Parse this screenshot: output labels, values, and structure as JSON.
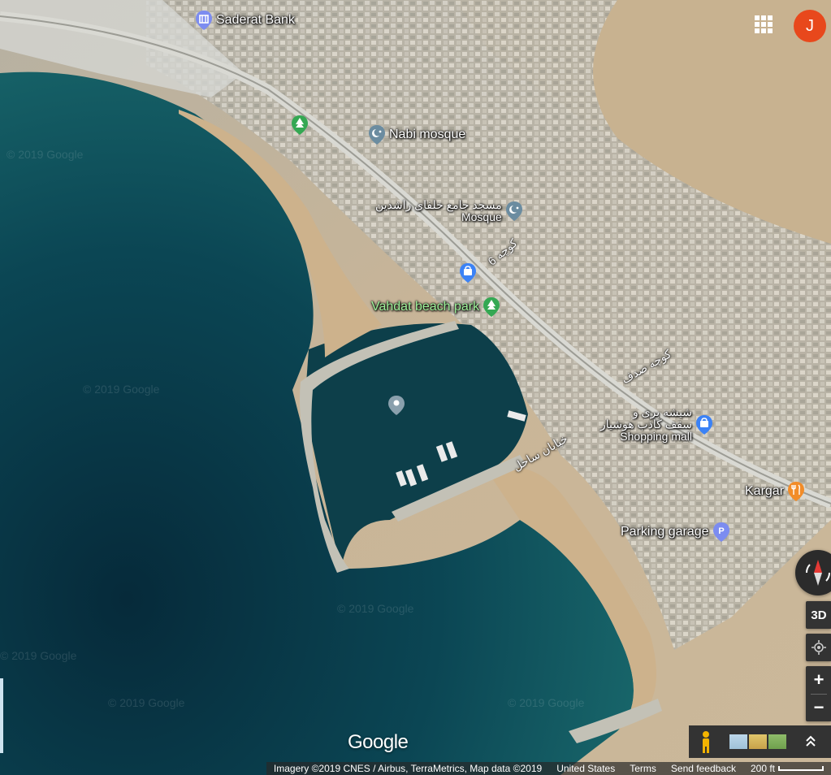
{
  "pois": [
    {
      "key": "saderat",
      "label": "Saderat Bank",
      "icon": "bank-pin-icon"
    },
    {
      "key": "nabi",
      "label": "Nabi mosque",
      "icon": "mosque-pin-icon"
    },
    {
      "key": "mosque_fa",
      "label": "مسجد جامع خلفای راشدین",
      "sublabel": "Mosque",
      "icon": "mosque-pin-icon"
    },
    {
      "key": "vahdat",
      "label": "Vahdat beach park",
      "icon": "park-pin-icon"
    },
    {
      "key": "mall_fa",
      "label": "شیشه بری و",
      "label2": "سقف کاذب هوشیار",
      "sublabel": "Shopping mall",
      "icon": "shopping-pin-icon"
    },
    {
      "key": "kargar",
      "label": "Kargar",
      "icon": "restaurant-pin-icon"
    },
    {
      "key": "parking",
      "label": "Parking garage",
      "icon": "parking-pin-icon"
    }
  ],
  "roads": {
    "r1": "کوچه 6",
    "r2": "کوچه صدف",
    "r3": "خیابان ساحل"
  },
  "watermark": "© 2019 Google",
  "account_initial": "J",
  "controls": {
    "three_d": "3D",
    "zoom_in": "+",
    "zoom_out": "−"
  },
  "logo": "Google",
  "footer": {
    "attribution": "Imagery ©2019 CNES / Airbus, TerraMetrics, Map data ©2019",
    "region": "United States",
    "terms": "Terms",
    "feedback": "Send feedback",
    "scale": "200 ft"
  },
  "colors": {
    "avatar": "#e8481c",
    "park": "#34a853",
    "mosque": "#6b8ca0",
    "shop": "#3b82f6",
    "food": "#f28c28",
    "parking": "#7c8cf0"
  }
}
